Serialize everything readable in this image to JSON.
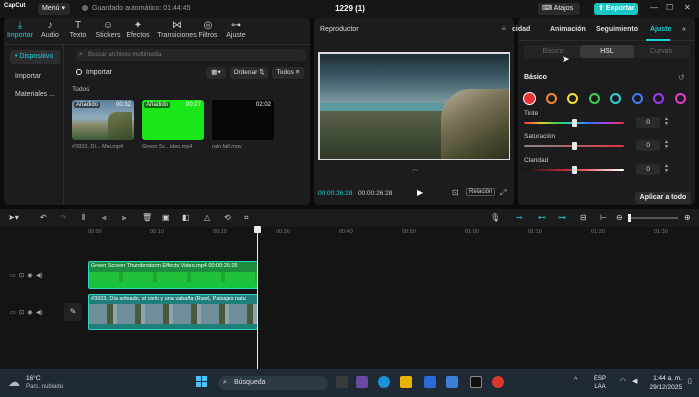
{
  "titlebar": {
    "logo": "CapCut",
    "menu_label": "Menú ▾",
    "autosave": "Guardado automático: 01:44:45",
    "project_title": "1229 (1)",
    "shortcuts_label": "Atajos",
    "export_label": "Exportar"
  },
  "toolbar": {
    "tabs": [
      {
        "label": "Importar",
        "icon": "import-icon"
      },
      {
        "label": "Audio",
        "icon": "audio-icon"
      },
      {
        "label": "Texto",
        "icon": "text-icon"
      },
      {
        "label": "Stickers",
        "icon": "sticker-icon"
      },
      {
        "label": "Efectos",
        "icon": "effects-icon"
      },
      {
        "label": "Transiciones",
        "icon": "transitions-icon"
      },
      {
        "label": "Filtros",
        "icon": "filters-icon"
      },
      {
        "label": "Ajuste",
        "icon": "adjust-icon"
      }
    ]
  },
  "sidebar": {
    "items": [
      {
        "label": "• Dispositivo"
      },
      {
        "label": "Importar"
      },
      {
        "label": "Materiales ..."
      }
    ]
  },
  "media": {
    "search_placeholder": "Buscar archivos multimedia",
    "import_label": "Importar",
    "sort_label": "Ordenar",
    "filter_label": "Todos",
    "section_label": "Todos",
    "items": [
      {
        "badge": "Añadido",
        "duration": "00:32",
        "name": "#3933, Dí... Mai.mp4"
      },
      {
        "badge": "Añadido",
        "duration": "00:27",
        "name": "Green Sc...ideo.mp4"
      },
      {
        "badge": "",
        "duration": "02:02",
        "name": "rain fall.mov"
      }
    ]
  },
  "player": {
    "title": "Reproductor",
    "current_time": "00:00:26:28",
    "total_time": "00:00:26:28",
    "ratio_label": "Relación"
  },
  "inspector": {
    "tabs": [
      "Animación",
      "Seguimiento",
      "Ajuste"
    ],
    "partial_tab": "cidad",
    "active_tab": "Ajuste",
    "segments": [
      "Básico",
      "HSL",
      "Curvas"
    ],
    "active_segment": "HSL",
    "section_label": "Básico",
    "swatch_colors": [
      "#e8333a",
      "#f0892c",
      "#f2dd2c",
      "#3bd14b",
      "#2ed0d2",
      "#3d7ef0",
      "#9a3cf0",
      "#e23cc8"
    ],
    "sliders": [
      {
        "label": "Tinte",
        "value": "0",
        "level": 0.5,
        "gradient": "linear-gradient(90deg,#e9353b,#e8c62b,#3bd14b,#2ec6e0,#3d6ef0,#b43ce0,#e9353b)"
      },
      {
        "label": "Saturación",
        "value": "0",
        "level": 0.5,
        "gradient": "linear-gradient(90deg,#888,#e0353b)"
      },
      {
        "label": "Claridad",
        "value": "0",
        "level": 0.5,
        "gradient": "linear-gradient(90deg,#111,#e0353b,#fff)"
      }
    ],
    "apply_all": "Aplicar a todo"
  },
  "timeline": {
    "ticks": [
      "00:00",
      "00:10",
      "00:20",
      "00:30",
      "00:40",
      "00:50",
      "01:00",
      "01:10",
      "01:20",
      "01:30"
    ],
    "clip_top": "Green Screen Thunderstorm Effects Video.mp4   00:00:26:28",
    "clip_bottom": "#3933, Día soleado, el cielo y una vabaña (Raw), Paisajes natu"
  },
  "taskbar": {
    "temperature": "16°C",
    "weather": "Parc. nublado",
    "search_label": "Búsqueda",
    "lang_top": "ESP",
    "lang_bottom": "LAA",
    "time": "1:44 a. m.",
    "date": "29/12/2025"
  }
}
